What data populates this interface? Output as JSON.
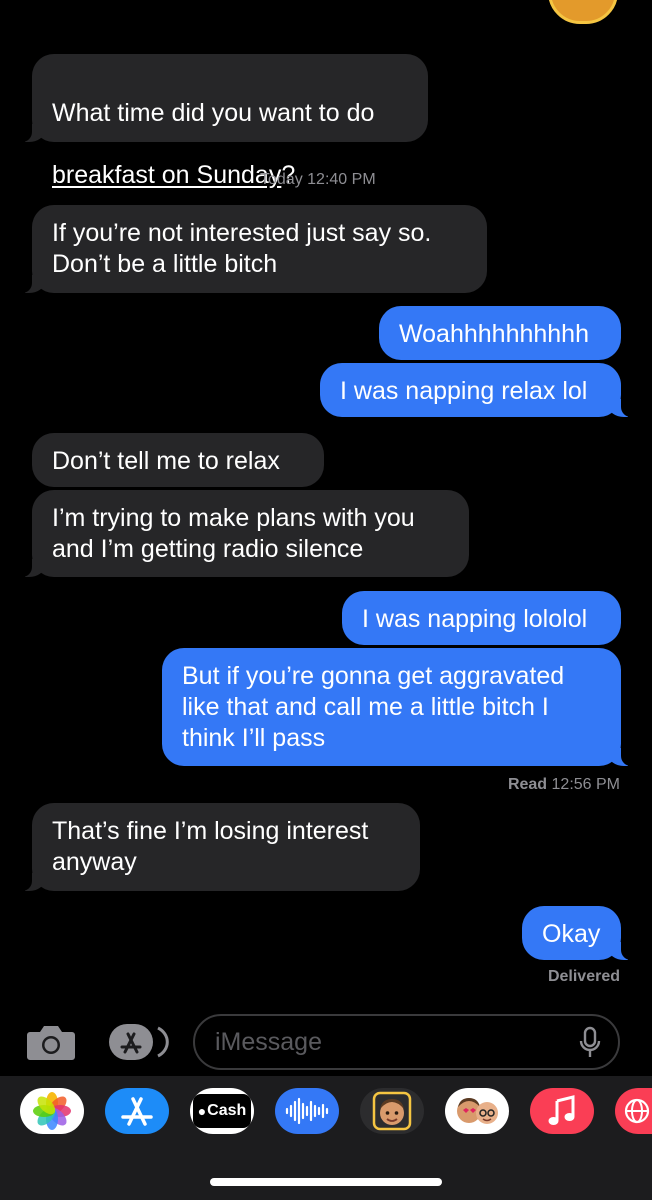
{
  "conversation": {
    "messages": [
      {
        "dir": "in",
        "text_pre": "What time did you want to do ",
        "text_link": "breakfast on Sunday",
        "text_post": "?"
      },
      {
        "dir": "in",
        "text": "If you’re not interested just say so.\nDon’t be a little bitch"
      },
      {
        "dir": "out",
        "text": "Woahhhhhhhhhh"
      },
      {
        "dir": "out",
        "text": "I was napping relax lol"
      },
      {
        "dir": "in",
        "text": "Don’t tell me to relax"
      },
      {
        "dir": "in",
        "text": "I’m trying to make plans with you\nand I’m getting radio silence"
      },
      {
        "dir": "out",
        "text": "I was napping lololol"
      },
      {
        "dir": "out",
        "text": "But if you’re gonna get aggravated\nlike that and call me a little bitch I\nthink I’ll pass"
      },
      {
        "dir": "in",
        "text": "That’s fine I’m losing interest\nanyway"
      },
      {
        "dir": "out",
        "text": "Okay"
      }
    ],
    "timestamp": {
      "day": "Today",
      "time": "12:40 PM"
    },
    "read_receipt": {
      "label": "Read",
      "time": "12:56 PM"
    },
    "delivered_label": "Delivered"
  },
  "input_bar": {
    "placeholder": "iMessage",
    "camera_icon": "camera-icon",
    "apps_icon": "app-store-icon",
    "mic_icon": "microphone-icon"
  },
  "app_drawer": {
    "apps": [
      {
        "name": "photos-icon"
      },
      {
        "name": "app-store-icon"
      },
      {
        "name": "apple-cash-icon",
        "label": "Cash"
      },
      {
        "name": "audio-message-icon"
      },
      {
        "name": "memoji-icon"
      },
      {
        "name": "memoji-stickers-icon"
      },
      {
        "name": "music-icon"
      },
      {
        "name": "web-search-icon"
      }
    ]
  },
  "colors": {
    "incoming": "#262628",
    "outgoing": "#3478f6",
    "background": "#000000"
  }
}
